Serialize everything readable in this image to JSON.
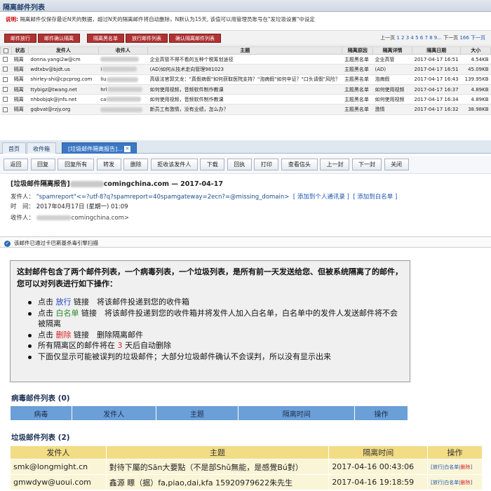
{
  "top": {
    "title": "隔离邮件列表",
    "desc_label": "说明:",
    "desc_text": "隔离邮件仅保存最近N天的数据，超过N天的隔离邮件将自动删除，N默认为15天, 该值可以用管理员账号在\"发垃圾设置\"中设定",
    "buttons": [
      "邮件放行",
      "邮件确认隔离",
      "隔离黑名单",
      "放行邮件列表",
      "确认隔离邮件列表"
    ],
    "pager": {
      "prev_label": "上一页",
      "pages": "1 2 3 4 5 6 7 8 9...",
      "next_label": "下一页",
      "total": "166 下一页"
    },
    "columns": [
      "状态",
      "发件人",
      "收件人",
      "主题",
      "隔离原因",
      "隔离详情",
      "隔离日期",
      "大小"
    ],
    "rows": [
      {
        "status": "隔离",
        "from": "donna.yangi2w@cm",
        "to": "",
        "subject": "企业高管不得不看的五种个税筹划途径",
        "reason": "主题黑名单",
        "detail": "企业高管",
        "date": "2017-04-17 16:51",
        "size": "4.54KB"
      },
      {
        "status": "隔离",
        "from": "wdtxbv@bjdt.us",
        "to": "i",
        "subject": "(AD)如何从技术走向管理981023",
        "reason": "主题黑名单",
        "detail": "(AD)",
        "date": "2017-04-17 16:51",
        "size": "45.09KB"
      },
      {
        "status": "隔离",
        "from": "shirley-shi@cpcprog.com",
        "to": "liu",
        "subject": "高级法官郭文龙：\"真假病假\"如何获取医院支持？\"泡病假\"如何辛证？\"口头请假\"风险？",
        "reason": "主题黑名单",
        "detail": "泡病假",
        "date": "2017-04-17 16:43",
        "size": "139.95KB"
      },
      {
        "status": "隔离",
        "from": "ttybigz@twang.net",
        "to": "hrl",
        "subject": "如何使用视频，音频软件制作教课",
        "reason": "主题黑名单",
        "detail": "如何使用视频",
        "date": "2017-04-17 16:37",
        "size": "4.89KB"
      },
      {
        "status": "隔离",
        "from": "nhbobjqk@jnfs.net",
        "to": "ca",
        "subject": "如何使用视频，音频软件制作教课",
        "reason": "主题黑名单",
        "detail": "如何使用视频",
        "date": "2017-04-17 16:34",
        "size": "4.89KB"
      },
      {
        "status": "隔离",
        "from": "gqbvat@rzjy.org",
        "to": "",
        "subject": "新员工有激情，没有业绩，怎么办？",
        "reason": "主题黑名单",
        "detail": "激情",
        "date": "2017-04-17 16:32",
        "size": "38.98KB"
      }
    ]
  },
  "tabs": [
    {
      "label": "首页"
    },
    {
      "label": "收件箱"
    },
    {
      "label": "[垃圾邮件隔离报告]..."
    }
  ],
  "actions": [
    "返回",
    "回复",
    "回复所有",
    "转发",
    "删除",
    "拒收该发件人",
    "下载",
    "回执",
    "打印",
    "查看信头",
    "上一封",
    "下一封",
    "关闭"
  ],
  "mail": {
    "subject_prefix": "[垃圾邮件隔离报告]",
    "subject_suffix": "comingchina.com — 2017-04-17",
    "from_label": "发件人：",
    "from_value": "\"spamreport\"<=?utf-8?q?spamreport=40spamgateway=2ecn?=@missing_domain>",
    "add_contact": "[ 添加到个人通讯录 ]",
    "add_whitelist": "[ 添加到白名单 ]",
    "time_label": "时　间：",
    "time_value": "2017年04月17日 (星期一) 01:09",
    "to_label": "收件人：",
    "to_value": "comingchina.com>"
  },
  "scan_text": "该邮件已通过卡巴斯基杀毒引擎扫描",
  "notice": {
    "intro": "这封邮件包含了两个邮件列表，一个病毒列表，一个垃圾列表，是所有前一天发送给您、但被系统隔离了的邮件，您可以对列表进行如下操作：",
    "item1_pre": "点击",
    "item1_link": "放行",
    "item1_post": "链接　将该邮件投递到您的收件箱",
    "item2_pre": "点击",
    "item2_link": "白名单",
    "item2_post": "链接　将该邮件投递到您的收件箱并将发件人加入白名单，白名单中的发件人发送邮件将不会被隔离",
    "item3_pre": "点击",
    "item3_link": "删除",
    "item3_post": "链接　删除隔离邮件",
    "item4_pre": "所有隔离区的邮件将在",
    "item4_days": "3",
    "item4_post": "天后自动删除",
    "item5": "下面仅显示可能被误判的垃圾邮件；大部分垃圾邮件确认不会误判，所以没有显示出来"
  },
  "virus": {
    "title": "病毒邮件列表 (0)",
    "columns": [
      "病毒",
      "发件人",
      "主题",
      "隔离时间",
      "操作"
    ]
  },
  "junk": {
    "title": "垃圾邮件列表 (2)",
    "columns": [
      "发件人",
      "主题",
      "隔离时间",
      "操作"
    ],
    "rows": [
      {
        "from": "smk@longmight.cn",
        "subject": "對待下屬的Sān大要點（不是部Shǔ無能，是感覺Bú對）",
        "time": "2017-04-16 00:43:06",
        "op_release": "放行",
        "op_white": "白名单",
        "op_delete": "删除"
      },
      {
        "from": "gmwdyw@uoui.com",
        "subject": "鑫源 瞟（据）fa,piao,dai,kfa 15920979622朱先生",
        "time": "2017-04-16 19:18:59",
        "op_release": "放行",
        "op_white": "白名单",
        "op_delete": "删除"
      }
    ]
  }
}
